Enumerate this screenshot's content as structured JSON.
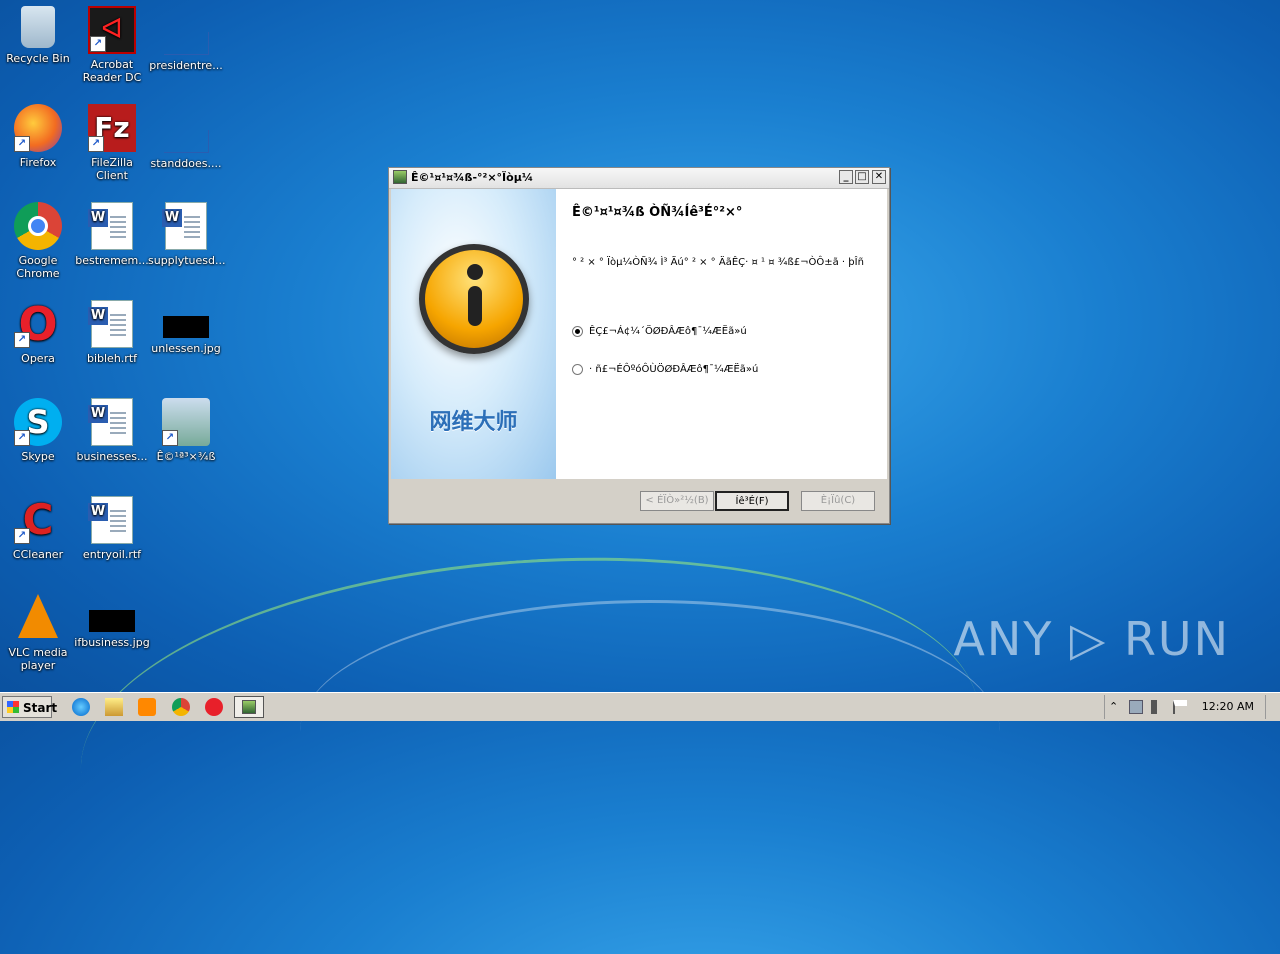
{
  "desktop": {
    "icons": [
      {
        "label": "Recycle Bin"
      },
      {
        "label": "Acrobat\nReader DC"
      },
      {
        "label": "presidentre..."
      },
      {
        "label": "Firefox"
      },
      {
        "label": "FileZilla Client"
      },
      {
        "label": "standdoes...."
      },
      {
        "label": "Google\nChrome"
      },
      {
        "label": "bestremem..."
      },
      {
        "label": "supplytuesd..."
      },
      {
        "label": "Opera"
      },
      {
        "label": "bibleh.rtf"
      },
      {
        "label": "unlessen.jpg"
      },
      {
        "label": "Skype"
      },
      {
        "label": "businesses..."
      },
      {
        "label": "Ê©¹ª³×¾ß"
      },
      {
        "label": "CCleaner"
      },
      {
        "label": "entryoil.rtf"
      },
      {
        "label": "VLC media\nplayer"
      },
      {
        "label": "ifbusiness.jpg"
      }
    ]
  },
  "dialog": {
    "title": "Ê©¹¤¹¤¾ß-°²×°Ïòµ¼",
    "heading": "Ê©¹¤¹¤¾ß ÒÑ¾­Íê³É°²×°",
    "description": "° ² × °  Ïòµ¼ÒÑ¾­ Ì³ Ãú°  ² × °  ÄãÊÇ· ¤ ¹  ¤ ¾ß£¬ÒÔ±ã · þÎñ",
    "radio_options": [
      {
        "label": "ÊÇ£¬Á¢¼´ÖØÐÂÆô¶¯¼ÆËã»ú",
        "selected": true
      },
      {
        "label": "· ñ£¬ÉÔºóÔÙÖØÐÂÆô¶¯¼ÆËã»ú",
        "selected": false
      }
    ],
    "brand_text": "网维大师",
    "buttons": {
      "back": "< ÉÏÒ»²½(B)",
      "finish": "Íê³É(F)",
      "cancel": "È¡Ïû(C)"
    },
    "window_buttons": {
      "minimize": "_",
      "maximize": "□",
      "close": "✕"
    }
  },
  "taskbar": {
    "start_label": "Start",
    "clock": "12:20 AM",
    "tray_expand": "⌃"
  },
  "watermark": "ANY ▷ RUN"
}
